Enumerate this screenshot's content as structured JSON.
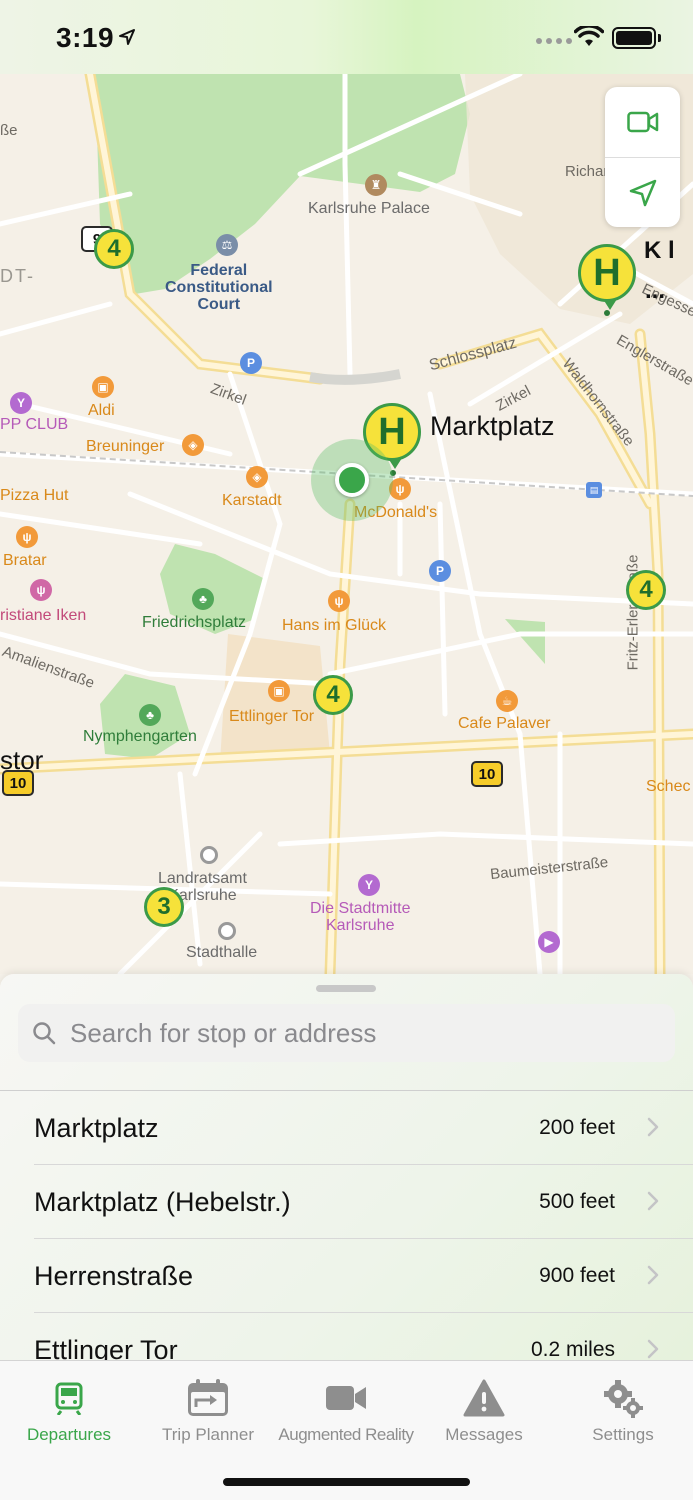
{
  "status_bar": {
    "time": "3:19"
  },
  "map": {
    "labels": {
      "karlsruhe_palace": "Karlsruhe Palace",
      "federal_court": "Federal\nConstitutional\nCourt",
      "aldi": "Aldi",
      "pp_club": "PP CLUB",
      "breuninger": "Breuninger",
      "karstadt": "Karstadt",
      "mcdonalds": "McDonald's",
      "pizza_hut": "Pizza Hut",
      "bratar": "Bratar",
      "christiane": "ristiane Iken",
      "friedrichsplatz": "Friedrichsplatz",
      "hans_im_glueck": "Hans im Glück",
      "ettlinger_tor": "Ettlinger Tor",
      "cafe_palaver": "Cafe Palaver",
      "nymphengarten": "Nymphengarten",
      "landratsamt": "Landratsamt\nKarlsruhe",
      "stadtmitte": "Die Stadtmitte\nKarlsruhe",
      "stadthalle": "Stadthalle",
      "sche": "Schec",
      "stor": "stor",
      "marktplatz": "Marktplatz",
      "kl": "K l",
      "ellipsis": "...",
      "dt": "DT-",
      "sse": "ße",
      "richar": "Richar",
      "engesse": "Engesse",
      "englerstrasse": "Englerstraße",
      "schlossplatz": "Schlossplatz",
      "zirkel_left": "Zirkel",
      "zirkel_right": "Zirkel",
      "waldhornstrasse": "Waldhornstraße",
      "amalienstrasse": "Amalienstraße",
      "fritz_erler": "Fritz-Erler-Straße",
      "baumeisterstrasse": "Baumeisterstraße"
    },
    "tram_lines": {
      "t1": "4",
      "t2": "4",
      "t3": "4",
      "t4": "3"
    },
    "stop_marker": "H",
    "shields": {
      "s1": "9",
      "s2": "10",
      "s3": "10"
    }
  },
  "search": {
    "placeholder": "Search for stop or address"
  },
  "stops": [
    {
      "name": "Marktplatz",
      "distance": "200 feet"
    },
    {
      "name": "Marktplatz (Hebelstr.)",
      "distance": "500 feet"
    },
    {
      "name": "Herrenstraße",
      "distance": "900 feet"
    },
    {
      "name": "Ettlinger Tor",
      "distance": "0.2 miles"
    }
  ],
  "tabs": [
    {
      "label": "Departures",
      "icon": "tram-icon",
      "active": true
    },
    {
      "label": "Trip Planner",
      "icon": "calendar-route-icon"
    },
    {
      "label": "Augmented Reality",
      "icon": "video-camera-icon"
    },
    {
      "label": "Messages",
      "icon": "warning-triangle-icon"
    },
    {
      "label": "Settings",
      "icon": "gears-icon"
    }
  ],
  "colors": {
    "accent": "#3aa64a",
    "tram_yellow": "#f6e23a",
    "tram_green": "#3b9a48"
  }
}
